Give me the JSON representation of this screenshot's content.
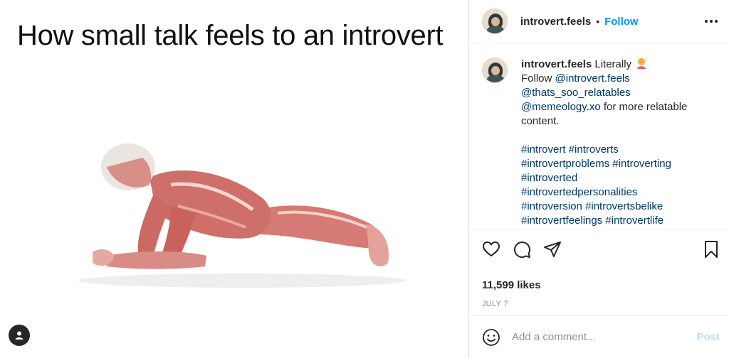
{
  "media": {
    "caption_text": "How small talk feels to an introvert",
    "figure_icon": "muscular-figure-plank",
    "user_tag_icon": "person-icon"
  },
  "header": {
    "username": "introvert.feels",
    "separator": "•",
    "follow_label": "Follow",
    "more_icon": "more-options-icon"
  },
  "caption": {
    "username": "introvert.feels",
    "text": " Literally",
    "emoji_icon": "facepalm-emoji",
    "line_follow": "Follow ",
    "mention_1": "@introvert.feels",
    "mention_2": "@thats_soo_relatables",
    "mention_3": "@memeology.xo",
    "mention_3_suffix": " for more relatable content.",
    "hashtags": [
      "#introvert #introverts",
      "#introvertproblems #introverting",
      "#introverted",
      "#introvertedpersonalities",
      "#introversion #introvertsbelike",
      "#introvertfeelings #introvertlife"
    ]
  },
  "actions": {
    "like_icon": "heart-icon",
    "comment_icon": "comment-icon",
    "share_icon": "share-icon",
    "save_icon": "bookmark-icon"
  },
  "likes_text": "11,599 likes",
  "date_text": "JULY 7",
  "add_comment": {
    "emoji_icon": "smile-icon",
    "placeholder": "Add a comment...",
    "post_label": "Post"
  },
  "colors": {
    "accent": "#0095f6",
    "link": "#00376b",
    "post_disabled": "#b2dffc",
    "muted": "#8e8e8e"
  }
}
